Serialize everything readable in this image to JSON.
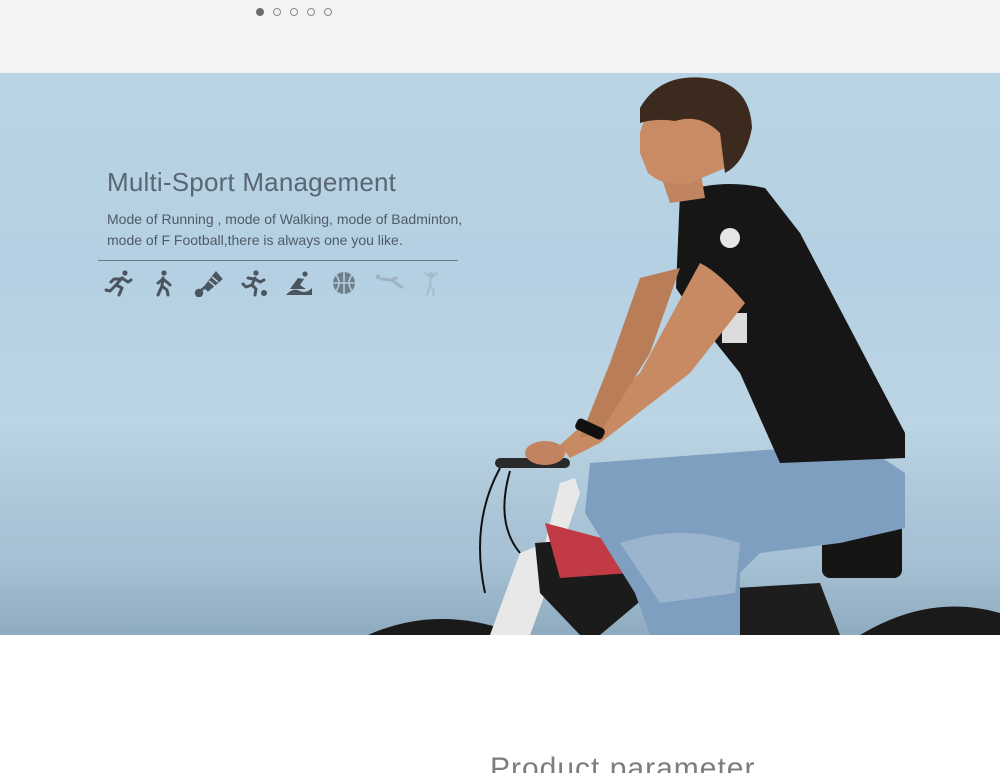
{
  "carousel": {
    "count": 5,
    "active_index": 0
  },
  "hero": {
    "title": "Multi-Sport Management",
    "description_line1": "Mode of Running , mode of Walking, mode of Badminton,",
    "description_line2": "mode of F Football,there is always one you like."
  },
  "sport_icons": [
    "running-icon",
    "walking-icon",
    "badminton-icon",
    "football-icon",
    "swimming-icon",
    "basketball-icon",
    "situp-icon",
    "yoga-icon"
  ],
  "colors": {
    "sky": "#b9d4e4",
    "sea": "#a8c3d4",
    "text": "#4f5b66",
    "heading": "#5a6673"
  },
  "bottom_heading": "Product parameter"
}
